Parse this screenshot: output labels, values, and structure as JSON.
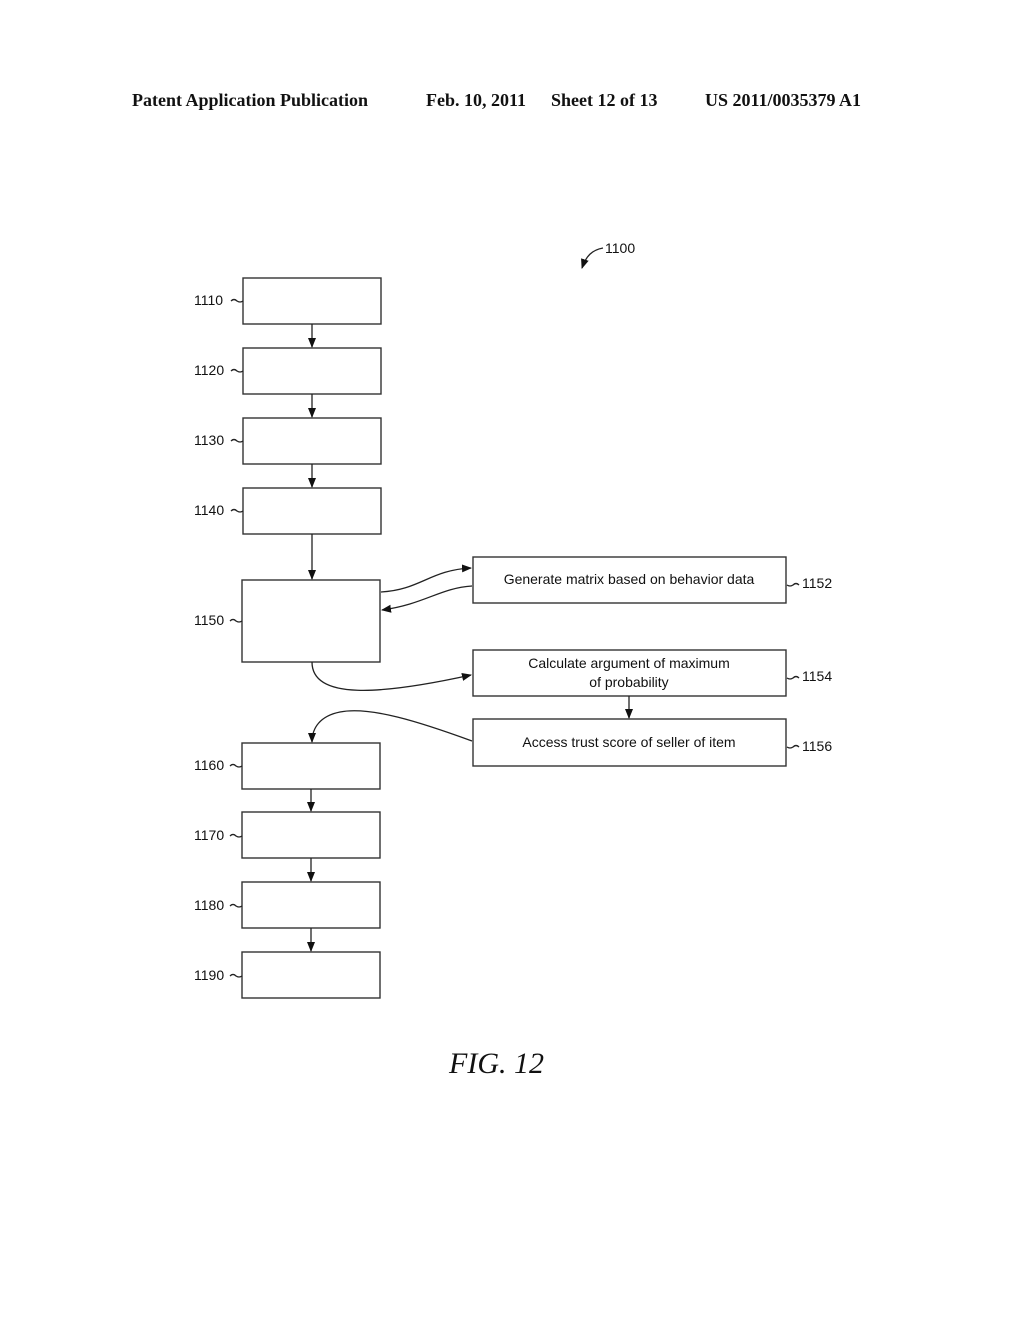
{
  "header": {
    "publication": "Patent Application Publication",
    "date": "Feb. 10, 2011",
    "sheet": "Sheet 12 of 13",
    "number": "US 2011/0035379 A1"
  },
  "diagram": {
    "ref": "1100",
    "figure_label": "FIG. 12",
    "main_steps": [
      {
        "ref": "1110",
        "text": ""
      },
      {
        "ref": "1120",
        "text": ""
      },
      {
        "ref": "1130",
        "text": ""
      },
      {
        "ref": "1140",
        "text": ""
      },
      {
        "ref": "1150",
        "text": ""
      },
      {
        "ref": "1160",
        "text": ""
      },
      {
        "ref": "1170",
        "text": ""
      },
      {
        "ref": "1180",
        "text": ""
      },
      {
        "ref": "1190",
        "text": ""
      }
    ],
    "sub_steps": [
      {
        "ref": "1152",
        "lines": [
          "Generate matrix based on behavior data"
        ]
      },
      {
        "ref": "1154",
        "lines": [
          "Calculate argument of maximum",
          "of probability"
        ]
      },
      {
        "ref": "1156",
        "lines": [
          "Access trust score of seller of item"
        ]
      }
    ]
  }
}
